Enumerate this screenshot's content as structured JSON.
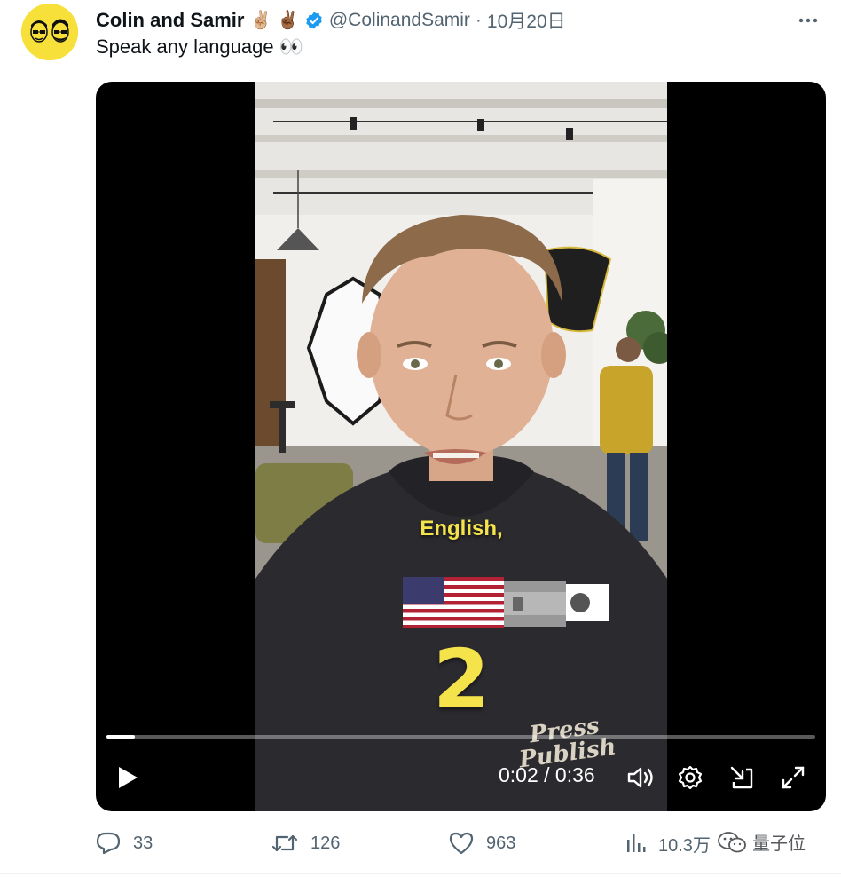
{
  "author": {
    "name": "Colin and Samir",
    "emoji": "✌🏼 ✌🏾",
    "handle": "@ColinandSamir",
    "separator": "·",
    "date": "10月20日"
  },
  "tweet": {
    "text": "Speak any language 👀"
  },
  "video": {
    "caption": "English,",
    "number": "2",
    "current_time": "0:02",
    "duration": "0:36",
    "time_text": "0:02 / 0:36",
    "progress": 0.04,
    "hoodie_text": "Press Publish"
  },
  "actions": {
    "replies": "33",
    "retweets": "126",
    "likes": "963",
    "views": "10.3万"
  },
  "watermark": {
    "text": "量子位"
  },
  "colors": {
    "avatar_bg": "#f7e03a",
    "verified": "#1d9bf0",
    "caption": "#f4e34a",
    "secondary_text": "#536471"
  }
}
